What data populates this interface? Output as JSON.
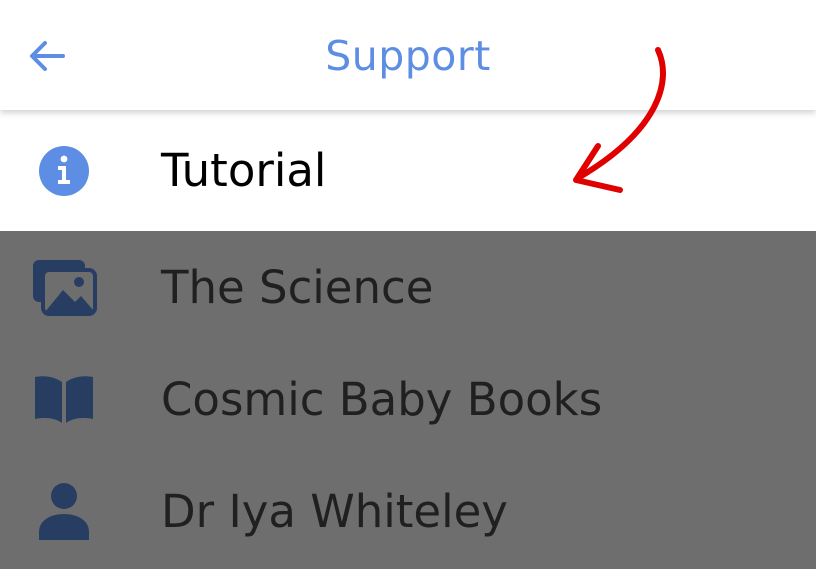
{
  "header": {
    "title": "Support"
  },
  "menu": {
    "items": [
      {
        "label": "Tutorial",
        "icon": "info-icon"
      },
      {
        "label": "The Science",
        "icon": "gallery-icon"
      },
      {
        "label": "Cosmic Baby Books",
        "icon": "book-icon"
      },
      {
        "label": "Dr Iya Whiteley",
        "icon": "person-icon"
      }
    ]
  },
  "colors": {
    "accent": "#5e8ee4",
    "annotation": "#e00000",
    "overlay": "rgba(0,0,0,0.57)"
  }
}
